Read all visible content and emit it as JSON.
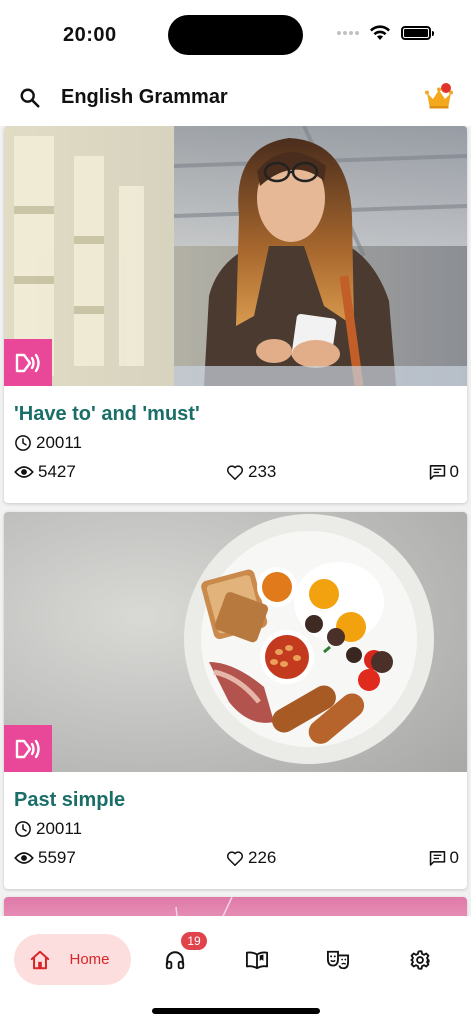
{
  "status_bar": {
    "time": "20:00"
  },
  "app_bar": {
    "title": "English Grammar",
    "search_icon": "search-icon",
    "premium_icon": "crown-icon",
    "colors": {
      "crown": "#f4a81d",
      "notification": "#e0342b"
    }
  },
  "feed": {
    "cards": [
      {
        "title": "'Have to' and 'must'",
        "time": "20011",
        "views": "5427",
        "likes": "233",
        "comments": "0",
        "badge_icon": "audio-icon"
      },
      {
        "title": "Past simple",
        "time": "20011",
        "views": "5597",
        "likes": "226",
        "comments": "0",
        "badge_icon": "audio-icon"
      }
    ]
  },
  "bottom_nav": {
    "home_label": "Home",
    "listen_badge": "19",
    "colors": {
      "active": "#d8262a",
      "active_bg": "#fddede",
      "badge": "#e0434c"
    }
  },
  "colors": {
    "title": "#1b6e68",
    "audio_badge": "#e94797"
  }
}
